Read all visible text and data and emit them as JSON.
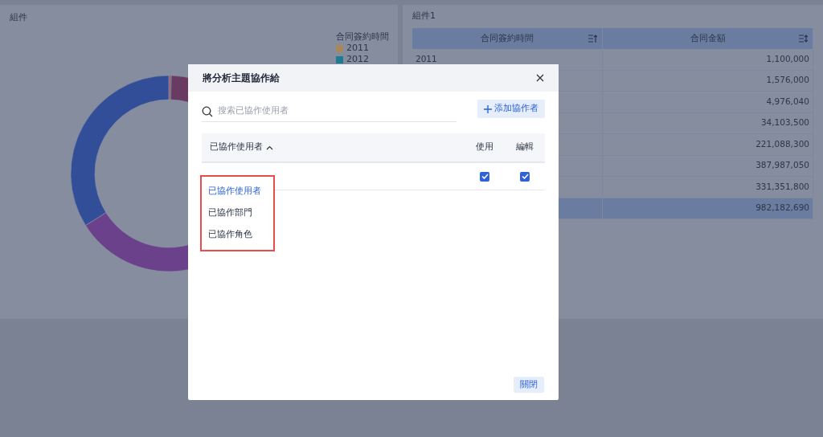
{
  "left_panel": {
    "title": "組件",
    "chart": {
      "legend_title": "合同簽約時間",
      "legend": [
        {
          "label": "2011",
          "color": "#a8875a"
        },
        {
          "label": "2012",
          "color": "#1f7a93"
        }
      ]
    }
  },
  "right_panel": {
    "title": "組件1",
    "table": {
      "columns": [
        {
          "label": "合同簽約時間",
          "kind": "ascending"
        },
        {
          "label": "合同金額",
          "kind": "sortable"
        }
      ],
      "rows": [
        {
          "year": "2011",
          "amount": "1,100,000"
        },
        {
          "amount": "1,576,000"
        },
        {
          "amount": "4,976,040"
        },
        {
          "amount": "34,103,500"
        },
        {
          "amount": "221,088,300"
        },
        {
          "amount": "387,987,050"
        },
        {
          "amount": "331,351,800"
        }
      ],
      "total": {
        "amount": "982,182,690"
      }
    }
  },
  "dialog": {
    "title": "將分析主題協作給",
    "search": {
      "placeholder": "搜索已協作使用者"
    },
    "add_button": "添加協作者",
    "list": {
      "columns": [
        {
          "label": "已協作使用者",
          "kind": "dropdown"
        },
        {
          "label": "使用",
          "kind": "check"
        },
        {
          "label": "編輯",
          "kind": "check"
        }
      ],
      "rows": [
        {
          "use": true,
          "edit": true
        }
      ]
    },
    "dropdown": {
      "expanded": true,
      "highlighted": true,
      "options": [
        {
          "label": "已協作使用者",
          "selected": true
        },
        {
          "label": "已協作部門",
          "selected": false
        },
        {
          "label": "已協作角色",
          "selected": false
        }
      ]
    },
    "close_button": "關閉"
  }
}
